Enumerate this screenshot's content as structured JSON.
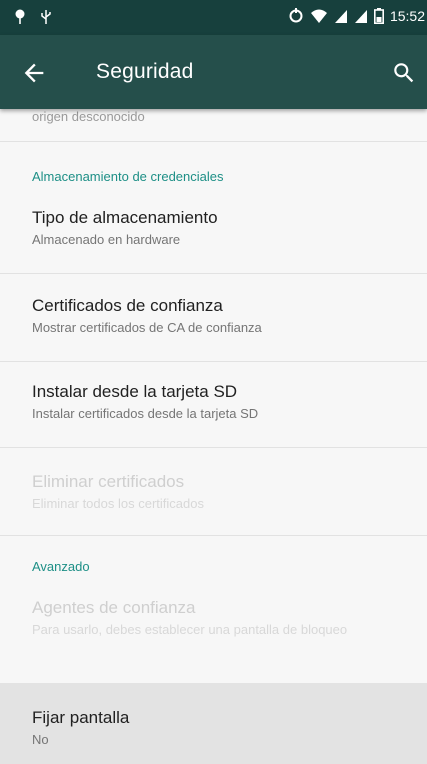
{
  "status_bar": {
    "time": "15:52",
    "icons": [
      "notification-pin-icon",
      "usb-icon",
      "sync-icon",
      "wifi-icon",
      "signal-icon",
      "signal-icon-2",
      "battery-icon"
    ]
  },
  "toolbar": {
    "title": "Seguridad",
    "back_icon": "arrow-back-icon",
    "search_icon": "search-icon"
  },
  "content": {
    "partial_summary": "origen desconocido",
    "categories": {
      "credentials": "Almacenamiento de credenciales",
      "advanced": "Avanzado"
    },
    "items": [
      {
        "title": "Tipo de almacenamiento",
        "summary": "Almacenado en hardware",
        "enabled": true
      },
      {
        "title": "Certificados de confianza",
        "summary": "Mostrar certificados de CA de confianza",
        "enabled": true
      },
      {
        "title": "Instalar desde la tarjeta SD",
        "summary": "Instalar certificados desde la tarjeta SD",
        "enabled": true
      },
      {
        "title": "Eliminar certificados",
        "summary": "Eliminar todos los certificados",
        "enabled": false
      },
      {
        "title": "Agentes de confianza",
        "summary": "Para usarlo, debes establecer una pantalla de bloqueo",
        "enabled": false
      },
      {
        "title": "Fijar pantalla",
        "summary": "No",
        "enabled": true
      }
    ]
  },
  "colors": {
    "status_bar": "#17403d",
    "toolbar": "#254f4b",
    "accent": "#1d8f86"
  }
}
